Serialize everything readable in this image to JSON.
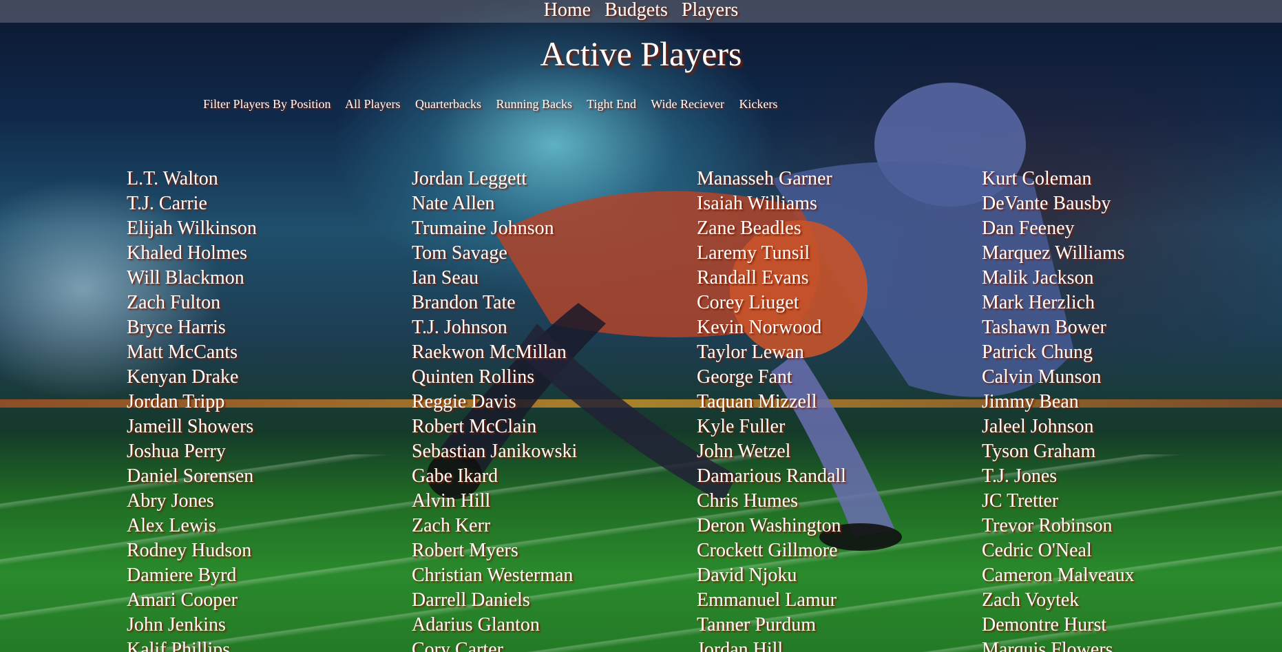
{
  "nav": {
    "home": "Home",
    "budgets": "Budgets",
    "players": "Players"
  },
  "title": "Active Players",
  "filters": {
    "label": "Filter Players By Position",
    "options": [
      "All Players",
      "Quarterbacks",
      "Running Backs",
      "Tight End",
      "Wide Reciever",
      "Kickers"
    ]
  },
  "columns": [
    [
      "L.T. Walton",
      "T.J. Carrie",
      "Elijah Wilkinson",
      "Khaled Holmes",
      "Will Blackmon",
      "Zach Fulton",
      "Bryce Harris",
      "Matt McCants",
      "Kenyan Drake",
      "Jordan Tripp",
      "Jameill Showers",
      "Joshua Perry",
      "Daniel Sorensen",
      "Abry Jones",
      "Alex Lewis",
      "Rodney Hudson",
      "Damiere Byrd",
      "Amari Cooper",
      "John Jenkins",
      "Kalif Phillips"
    ],
    [
      "Jordan Leggett",
      "Nate Allen",
      "Trumaine Johnson",
      "Tom Savage",
      "Ian Seau",
      "Brandon Tate",
      "T.J. Johnson",
      "Raekwon McMillan",
      "Quinten Rollins",
      "Reggie Davis",
      "Robert McClain",
      "Sebastian Janikowski",
      "Gabe Ikard",
      "Alvin Hill",
      "Zach Kerr",
      "Robert Myers",
      "Christian Westerman",
      "Darrell Daniels",
      "Adarius Glanton",
      "Cory Carter"
    ],
    [
      "Manasseh Garner",
      "Isaiah Williams",
      "Zane Beadles",
      "Laremy Tunsil",
      "Randall Evans",
      "Corey Liuget",
      "Kevin Norwood",
      "Taylor Lewan",
      "George Fant",
      "Taquan Mizzell",
      "Kyle Fuller",
      "John Wetzel",
      "Damarious Randall",
      "Chris Humes",
      "Deron Washington",
      "Crockett Gillmore",
      "David Njoku",
      "Emmanuel Lamur",
      "Tanner Purdum",
      "Jordan Hill"
    ],
    [
      "Kurt Coleman",
      "DeVante Bausby",
      "Dan Feeney",
      "Marquez Williams",
      "Malik Jackson",
      "Mark Herzlich",
      "Tashawn Bower",
      "Patrick Chung",
      "Calvin Munson",
      "Jimmy Bean",
      "Jaleel Johnson",
      "Tyson Graham",
      "T.J. Jones",
      "JC Tretter",
      "Trevor Robinson",
      "Cedric O'Neal",
      "Cameron Malveaux",
      "Zach Voytek",
      "Demontre Hurst",
      "Marquis Flowers"
    ]
  ]
}
